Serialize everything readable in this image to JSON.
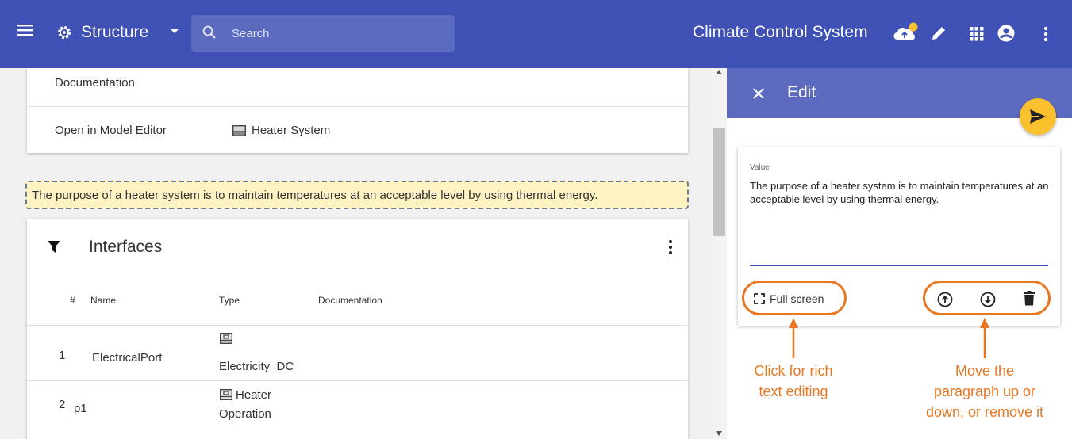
{
  "header": {
    "view_title": "Structure",
    "search_placeholder": "Search",
    "project_name": "Climate Control System",
    "colors": {
      "bar": "#3f51b5",
      "accent": "#fbc02d"
    }
  },
  "properties": {
    "documentation_label": "Documentation",
    "model_editor_label": "Open in Model Editor",
    "model_editor_value": "Heater System"
  },
  "note": "The purpose of a heater system is to maintain temperatures at an acceptable level by using thermal energy.",
  "interfaces": {
    "title": "Interfaces",
    "columns": [
      "#",
      "Name",
      "Type",
      "Documentation"
    ],
    "rows": [
      {
        "num": "1",
        "name": "ElectricalPort",
        "type": "Electricity_DC"
      },
      {
        "num": "2",
        "name": "p1",
        "type_line1": "Heater",
        "type_line2": "Operation"
      }
    ]
  },
  "panel": {
    "title": "Edit",
    "value_label": "Value",
    "value_text": "The purpose of a heater system is to maintain temperatures at an acceptable level by using thermal energy.",
    "fullscreen_label": "Full screen"
  },
  "annotations": {
    "left_line1": "Click for rich",
    "left_line2": "text editing",
    "right_line1": "Move the",
    "right_line2": "paragraph up or",
    "right_line3": "down, or remove it"
  }
}
